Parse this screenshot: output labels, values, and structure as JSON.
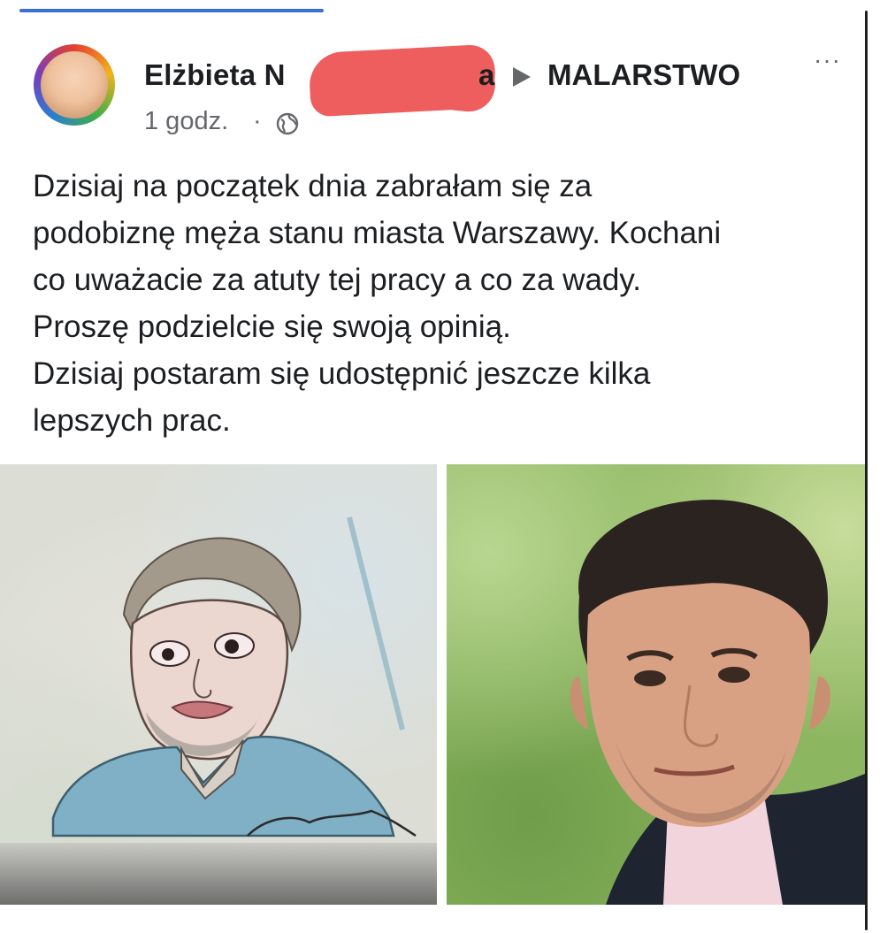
{
  "post": {
    "author_visible_start": "Elżbieta N",
    "author_visible_end": "a",
    "group": "MALARSTWO",
    "time": "1 godz.",
    "dot": "·",
    "more": "···",
    "text_lines": [
      "Dzisiaj na początek dnia zabrałam się za",
      "podobiznę męża stanu miasta Warszawy. Kochani",
      "co uważacie za atuty tej pracy a co za wady.",
      "Proszę podzielcie się swoją opinią.",
      "Dzisiaj postaram się udostępnić jeszcze kilka",
      "lepszych prac."
    ]
  },
  "colors": {
    "accent": "#3b6fd8",
    "redaction": "#ef5e5e",
    "meta_text": "#65676b"
  },
  "icons": {
    "privacy": "globe-icon",
    "menu": "more-icon",
    "separator": "triangle-right-icon"
  }
}
